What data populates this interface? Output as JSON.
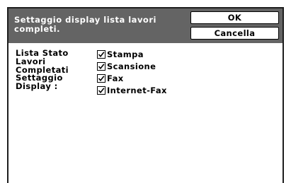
{
  "dialog": {
    "title_line1": "Settaggio display lista lavori",
    "title_line2": "completi.",
    "ok_label": "OK",
    "cancel_label": "Cancella"
  },
  "settings": {
    "label_lines": [
      "Lista Stato",
      "Lavori",
      "Completati",
      "Settaggio",
      "Display :"
    ],
    "options": [
      {
        "label": "Stampa",
        "checked": true
      },
      {
        "label": "Scansione",
        "checked": true
      },
      {
        "label": "Fax",
        "checked": true
      },
      {
        "label": "Internet-Fax",
        "checked": true
      }
    ]
  },
  "colors": {
    "header_bg": "#646464",
    "border": "#1e1e1e"
  }
}
